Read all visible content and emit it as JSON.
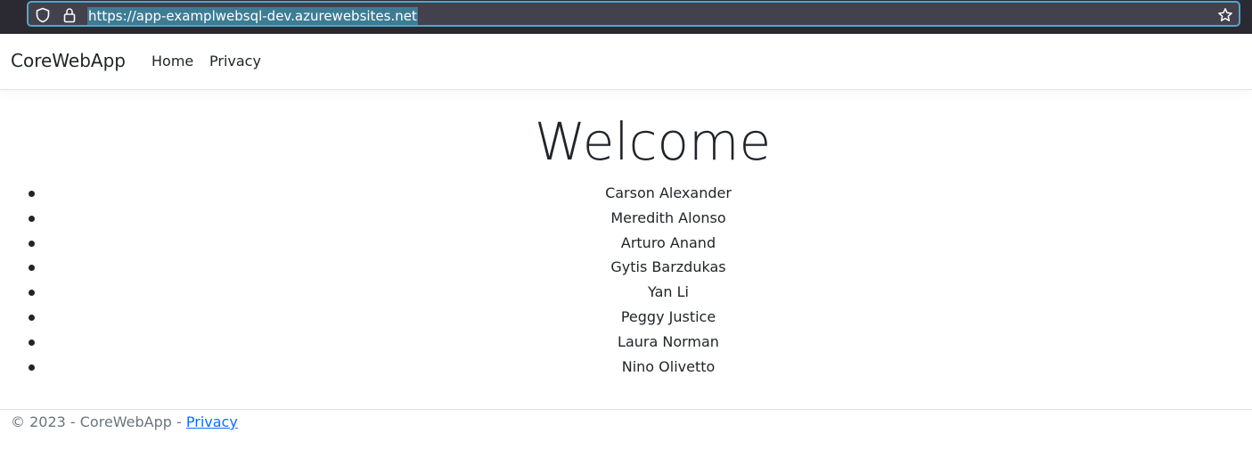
{
  "browser": {
    "url": "https://app-examplwebsql-dev.azurewebsites.net",
    "icons": [
      "shield-icon",
      "lock-icon",
      "star-icon"
    ]
  },
  "navbar": {
    "brand": "CoreWebApp",
    "links": [
      "Home",
      "Privacy"
    ]
  },
  "main": {
    "heading": "Welcome",
    "students": [
      "Carson Alexander",
      "Meredith Alonso",
      "Arturo Anand",
      "Gytis Barzdukas",
      "Yan Li",
      "Peggy Justice",
      "Laura Norman",
      "Nino Olivetto"
    ]
  },
  "footer": {
    "text": "© 2023 - CoreWebApp - ",
    "link": "Privacy",
    "link_color": "#0d6efd"
  }
}
